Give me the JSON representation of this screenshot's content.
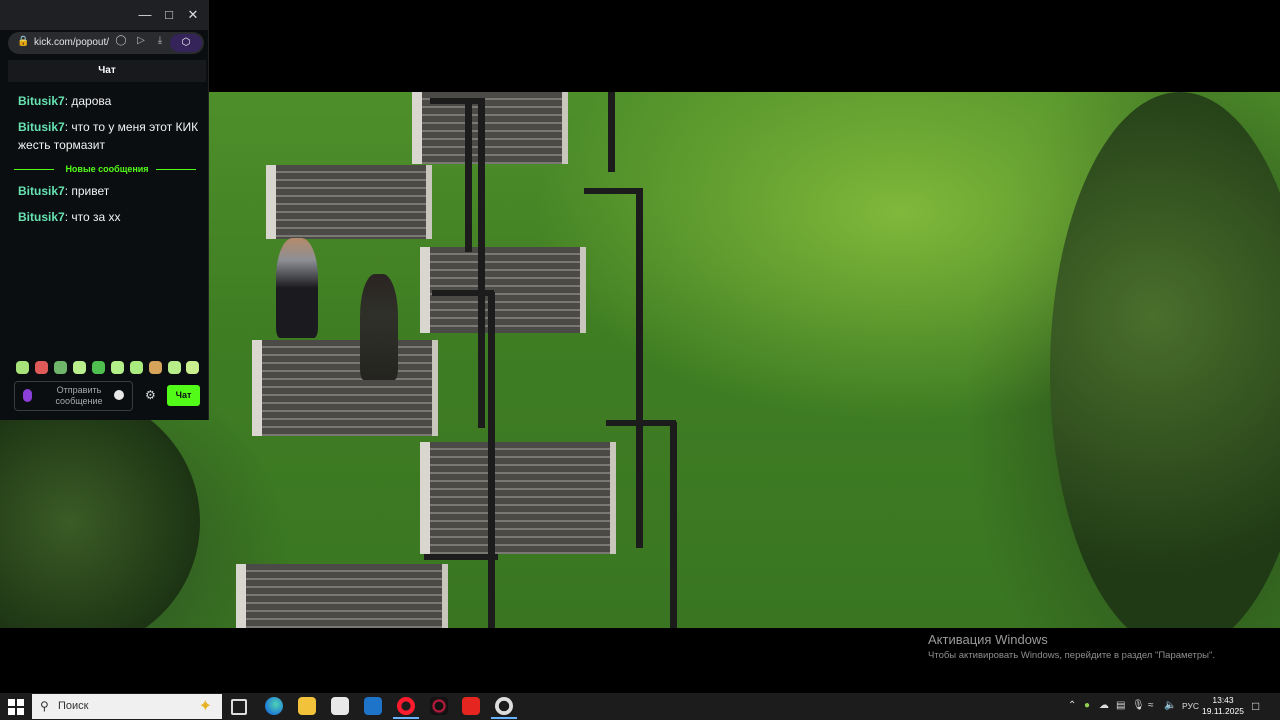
{
  "browser": {
    "url": "kick.com/popout/",
    "chat_header": "Чат"
  },
  "chat": {
    "messages_before": [
      {
        "user": "Bitusik7",
        "text": "дарова"
      },
      {
        "user": "Bitusik7",
        "text": "что то у меня этот КИК жесть тормазит"
      }
    ],
    "new_messages_label": "Новые сообщения",
    "messages_after": [
      {
        "user": "Bitusik7",
        "text": "привет"
      },
      {
        "user": "Bitusik7",
        "text": "что за хх"
      }
    ],
    "input_placeholder": "Отправить сообщение",
    "send_label": "Чат"
  },
  "activation": {
    "title": "Активация Windows",
    "subtitle": "Чтобы активировать Windows, перейдите в раздел \"Параметры\"."
  },
  "taskbar": {
    "search_placeholder": "Поиск",
    "language": "РУС",
    "time": "13:43",
    "date": "19.11.2025",
    "apps": [
      "task-view",
      "edge",
      "file-explorer",
      "microsoft-store",
      "outlook",
      "opera",
      "opera-gx",
      "yandex-browser",
      "obs"
    ]
  },
  "colors": {
    "kick_green": "#53fc18",
    "username": "#7de0ff",
    "grass": "#4f8f2a"
  }
}
